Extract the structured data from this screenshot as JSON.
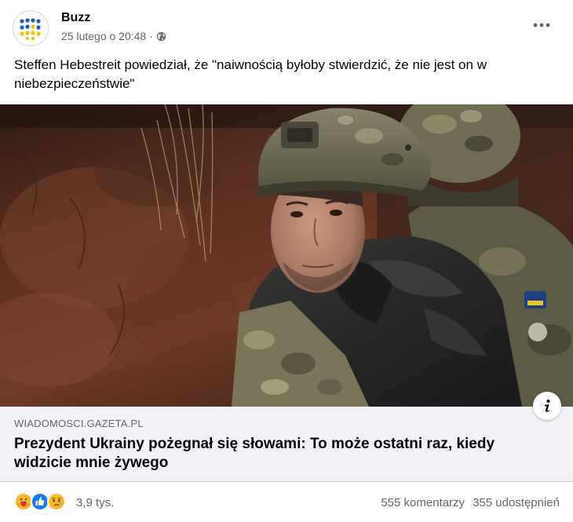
{
  "post": {
    "author": "Buzz",
    "date": "25 lutego o 20:48",
    "separator": "·",
    "privacy_icon": "globe-icon",
    "more_icon": "more-dots-icon",
    "text": "Steffen Hebestreit powiedział, że \"naiwnością byłoby stwierdzić, że nie jest on w niebezpieczeństwie\""
  },
  "link": {
    "domain": "WIADOMOSCI.GAZETA.PL",
    "title": "Prezydent Ukrainy pożegnał się słowami: To może ostatni raz, kiedy widzicie mnie żywego",
    "info_icon": "info-icon"
  },
  "footer": {
    "reaction_icons": [
      "care-icon",
      "like-icon",
      "sad-icon"
    ],
    "reactions_count": "3,9 tys.",
    "comments": "555 komentarzy",
    "shares": "355 udostępnień"
  },
  "colors": {
    "text": "#050505",
    "secondary_text": "#65676b",
    "link_preview_bg": "#f0f2f5",
    "like_blue": "#1877f2",
    "emoji_yellow": "#f7b928",
    "avatar_blue": "#1d5bbf",
    "avatar_yellow": "#f5c400"
  }
}
